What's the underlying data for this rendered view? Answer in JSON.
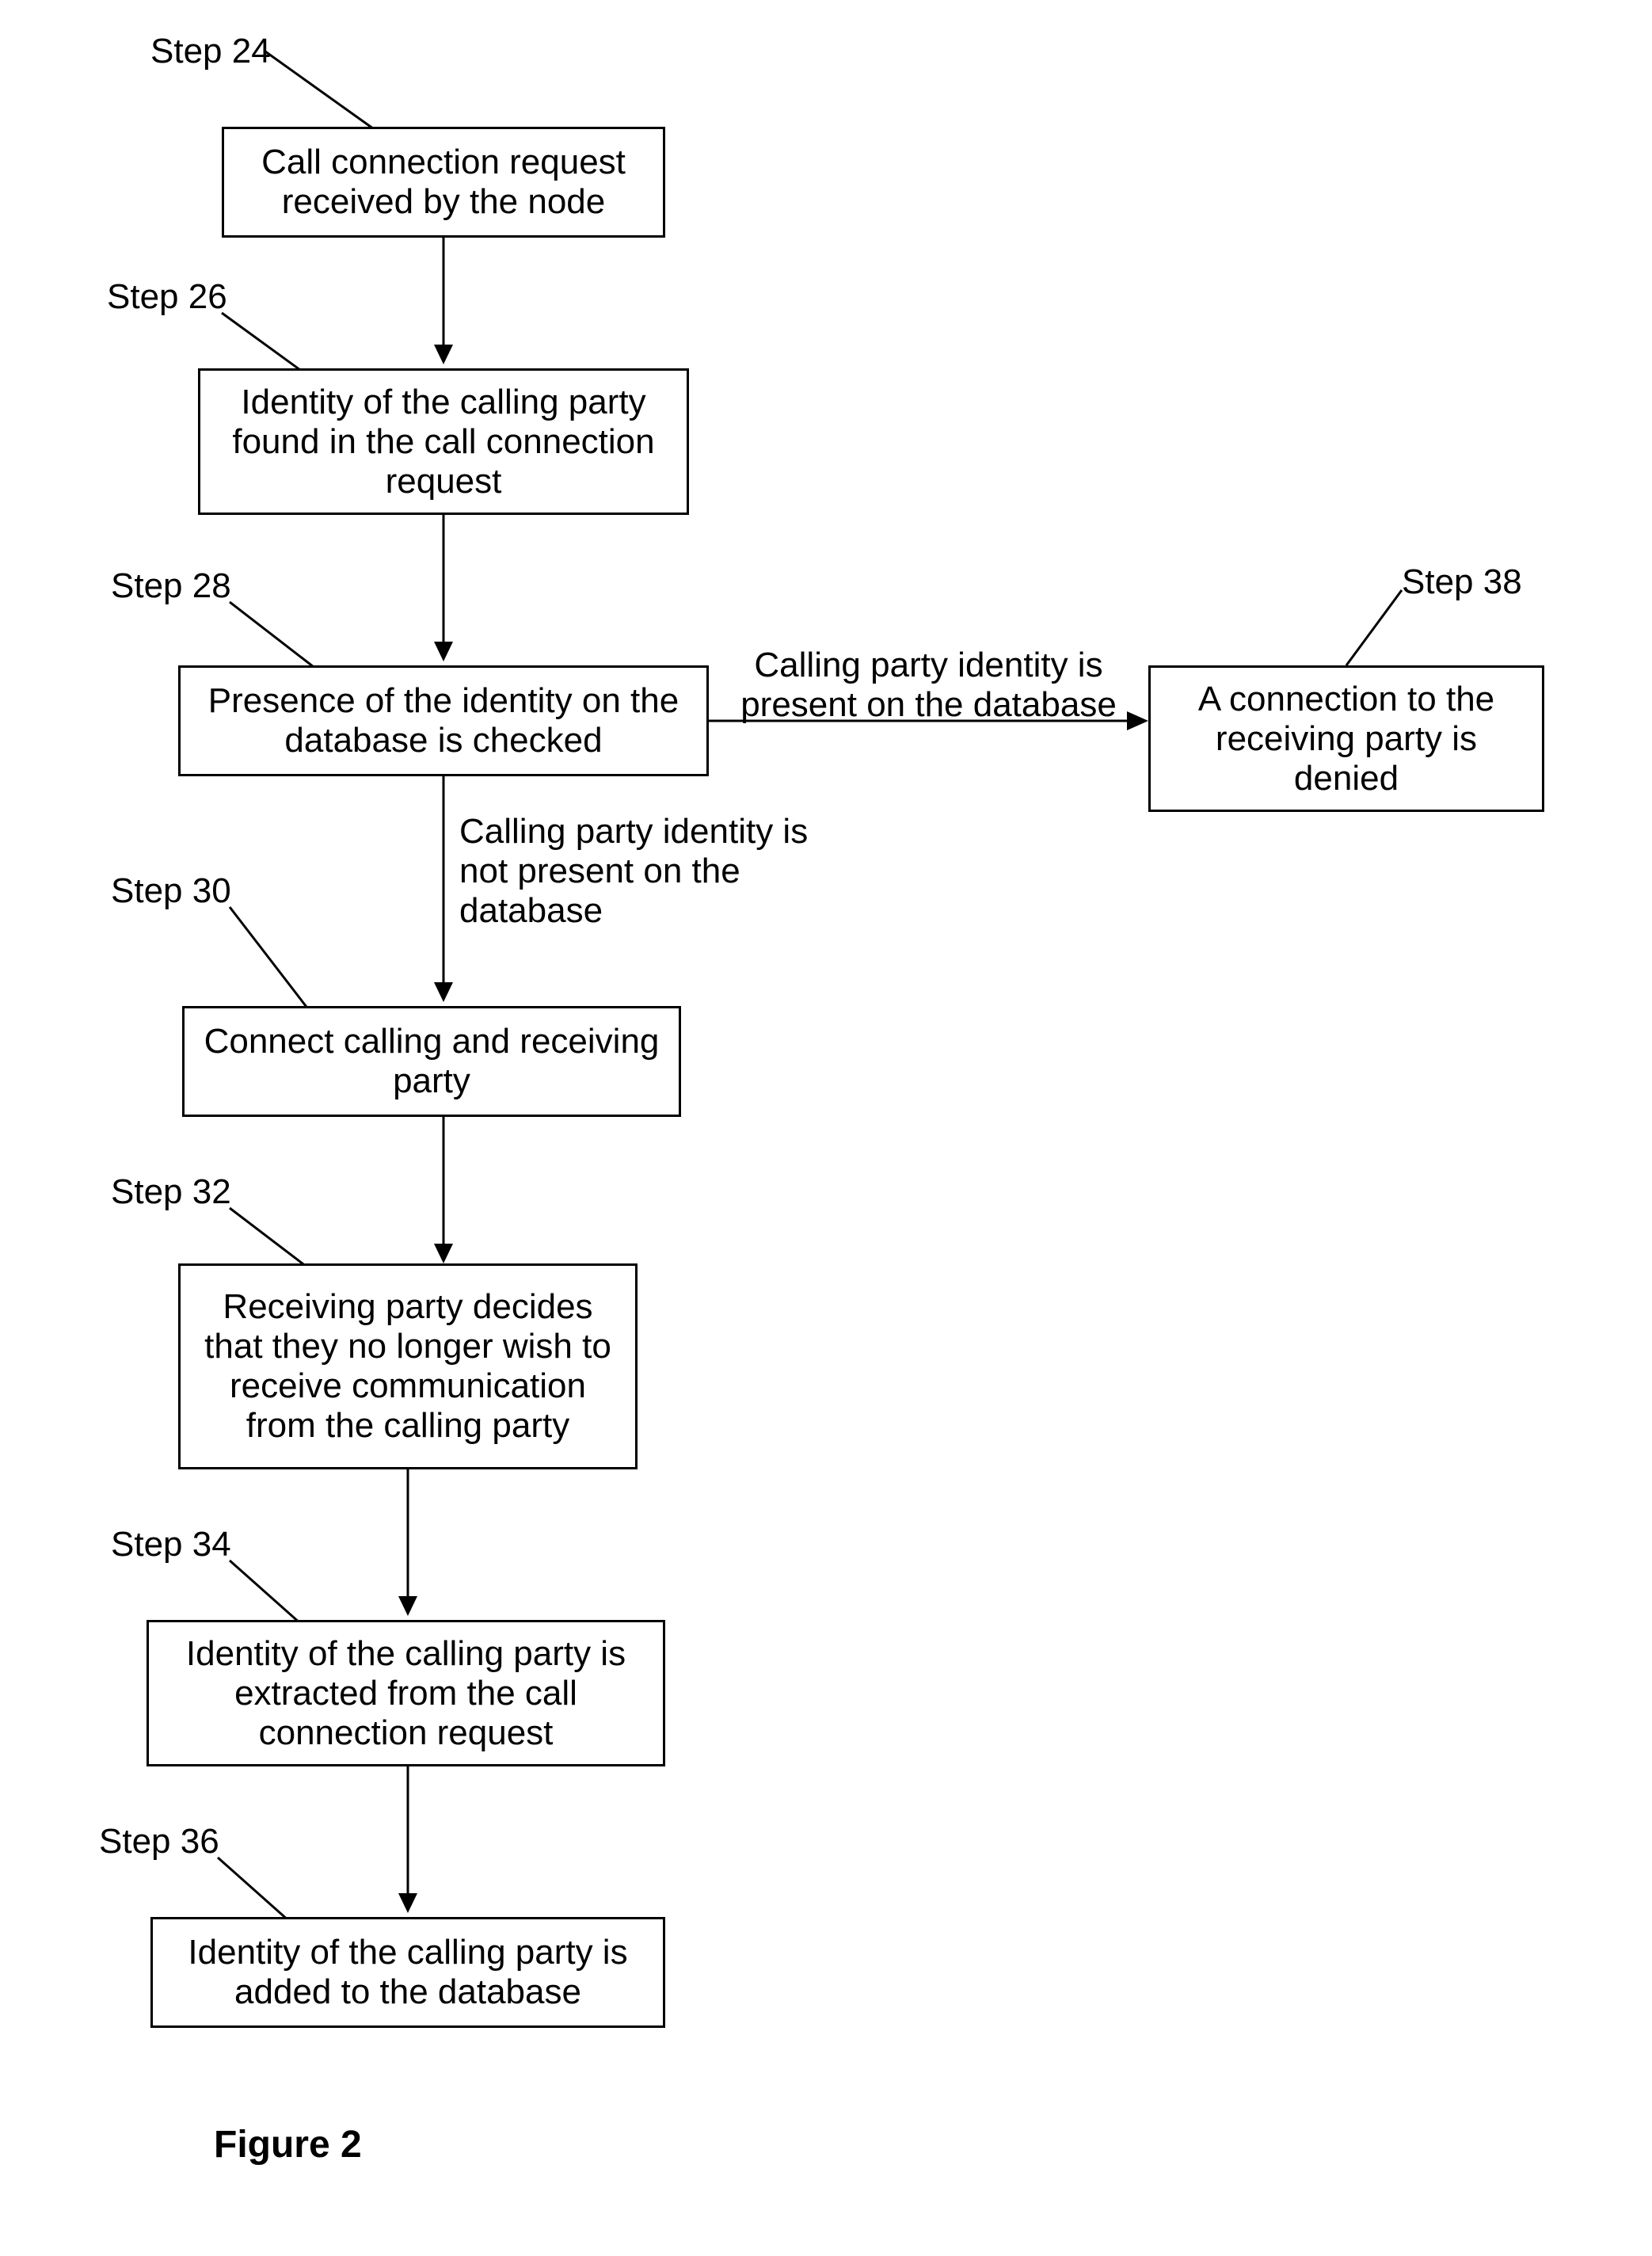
{
  "figure_label": "Figure 2",
  "steps": {
    "s24": {
      "label": "Step 24",
      "text": "Call connection request received by the node"
    },
    "s26": {
      "label": "Step 26",
      "text": "Identity of the calling party found in the call connection request"
    },
    "s28": {
      "label": "Step 28",
      "text": "Presence of the identity on the database is checked"
    },
    "s30": {
      "label": "Step 30",
      "text": "Connect calling and receiving party"
    },
    "s32": {
      "label": "Step 32",
      "text": "Receiving party decides that they no longer wish to receive communication from the calling party"
    },
    "s34": {
      "label": "Step 34",
      "text": "Identity of the calling party is extracted from the call connection request"
    },
    "s36": {
      "label": "Step 36",
      "text": "Identity of the calling party is added to the database"
    },
    "s38": {
      "label": "Step 38",
      "text": "A connection to the receiving party is denied"
    }
  },
  "edges": {
    "e28_38": "Calling party identity is present on the database",
    "e28_30": "Calling party identity is not present on the database"
  }
}
